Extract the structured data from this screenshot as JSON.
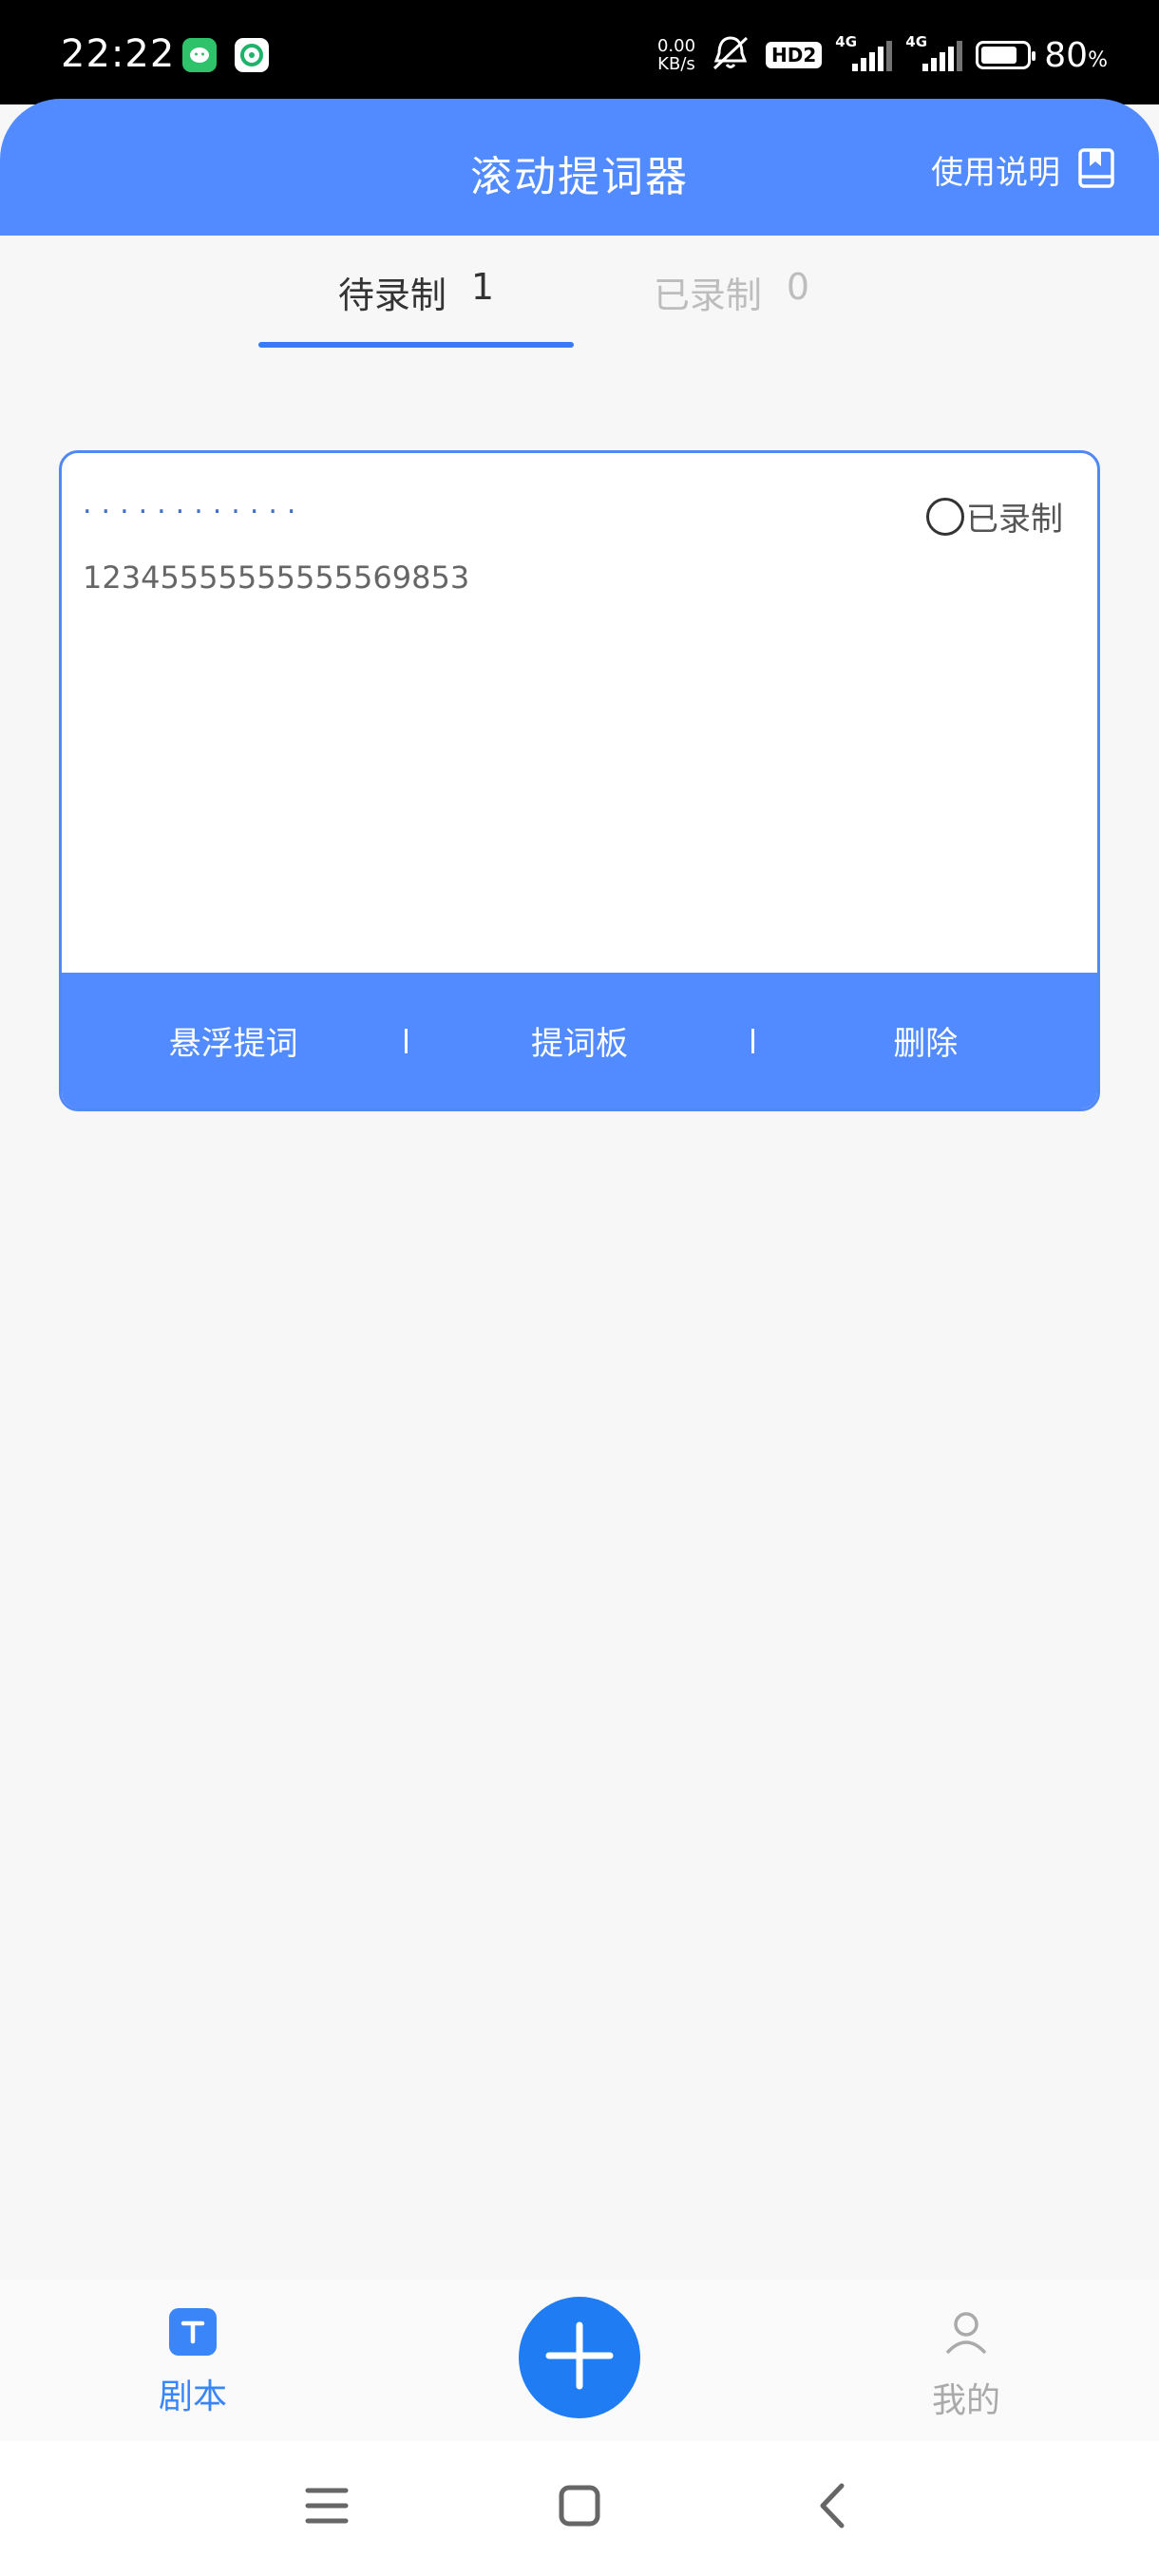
{
  "status_bar": {
    "time": "22:22",
    "net_speed_value": "0.00",
    "net_speed_unit": "KB/s",
    "hd_badge": "HD2",
    "signal_1_label": "4G",
    "signal_2_label": "4G",
    "battery_percent": "80",
    "battery_percent_sign": "%",
    "battery_level": 0.8
  },
  "header": {
    "title": "滚动提词器",
    "help_label": "使用说明",
    "background_color": "#518bff"
  },
  "tabs": [
    {
      "label": "待录制",
      "count": "1",
      "active": true
    },
    {
      "label": "已录制",
      "count": "0",
      "active": false
    }
  ],
  "script_card": {
    "title": "............",
    "record_status_label": "已录制",
    "content": "12345555555555569853",
    "actions": {
      "float_prompt": "悬浮提词",
      "prompt_board": "提词板",
      "delete": "删除"
    }
  },
  "bottom_nav": {
    "script_label": "剧本",
    "script_icon_glyph": "T",
    "mine_label": "我的",
    "active_color": "#3a86f8"
  },
  "icons": {
    "help": "book-icon",
    "add": "plus-icon",
    "script": "text-t-icon",
    "mine": "user-icon",
    "menu": "menu-icon",
    "home": "home-square-icon",
    "back": "back-chevron-icon"
  }
}
